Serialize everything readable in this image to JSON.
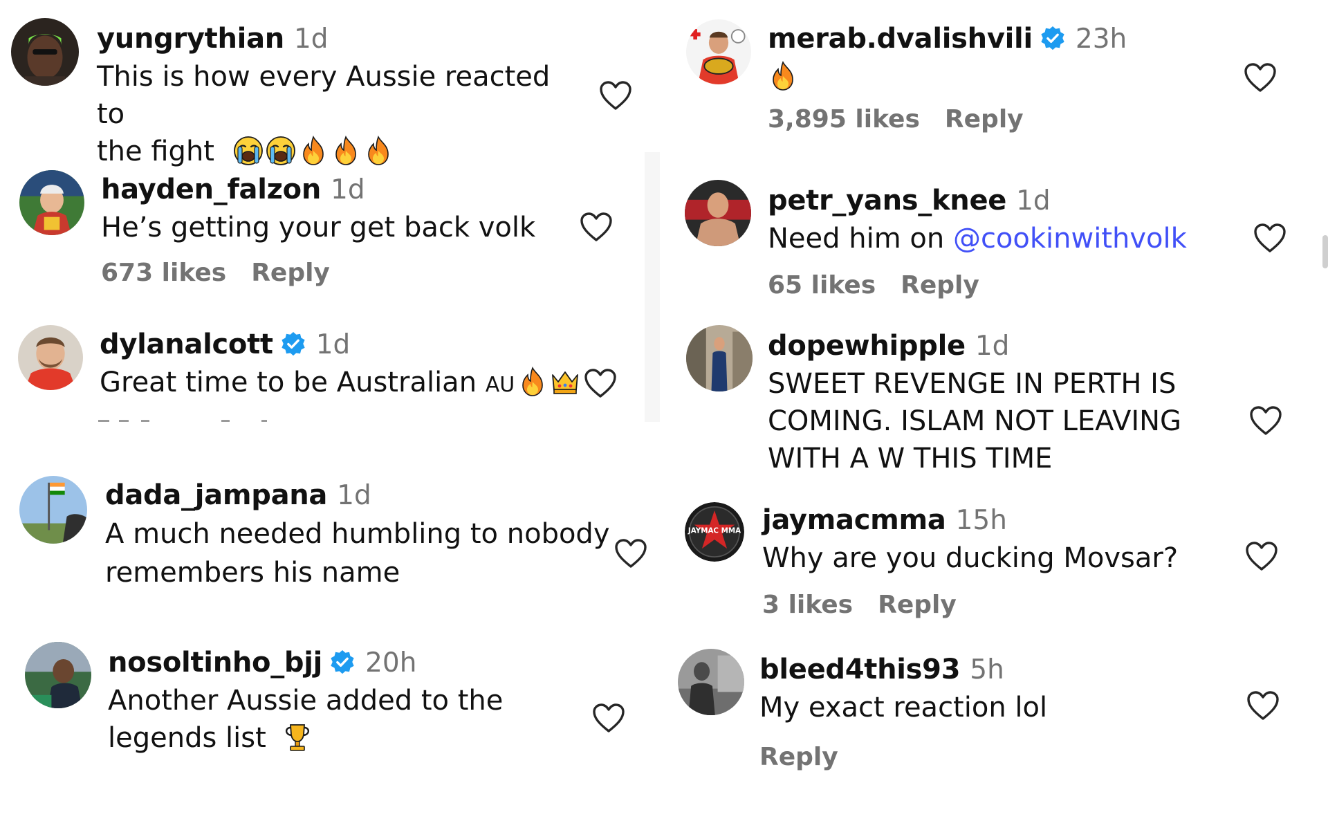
{
  "colors": {
    "text": "#111111",
    "muted": "#737373",
    "mention": "#4150f7",
    "verified": "#1d9bf0",
    "background": "#ffffff"
  },
  "comments": [
    {
      "username": "yungrythian",
      "verified": false,
      "time": "1d",
      "text_line1": "This is how every Aussie reacted to",
      "text_line2": "the fight",
      "emojis": [
        "crying-face",
        "crying-face",
        "fire",
        "fire",
        "fire"
      ],
      "likes": "",
      "reply": ""
    },
    {
      "username": "hayden_falzon",
      "verified": false,
      "time": "1d",
      "text": "He’s getting your get back volk",
      "likes": "673 likes",
      "reply": "Reply"
    },
    {
      "username": "dylanalcott",
      "verified": true,
      "time": "1d",
      "text": "Great time to be Australian",
      "flag_code": "AU",
      "emojis": [
        "fire",
        "crown"
      ],
      "likes": "",
      "reply": ""
    },
    {
      "username": "dada_jampana",
      "verified": false,
      "time": "1d",
      "text_line1": "A much needed humbling to nobody",
      "text_line2": "remembers his name",
      "likes": "",
      "reply": ""
    },
    {
      "username": "nosoltinho_bjj",
      "verified": true,
      "time": "20h",
      "text_line1": "Another Aussie added to the",
      "text_line2": "legends list",
      "emojis": [
        "trophy"
      ],
      "likes": "",
      "reply": ""
    },
    {
      "username": "merab.dvalishvili",
      "verified": true,
      "time": "23h",
      "emojis": [
        "fire"
      ],
      "likes": "3,895 likes",
      "reply": "Reply"
    },
    {
      "username": "petr_yans_knee",
      "verified": false,
      "time": "1d",
      "text": "Need him on ",
      "mention": "@cookinwithvolk",
      "likes": "65 likes",
      "reply": "Reply"
    },
    {
      "username": "dopewhipple",
      "verified": false,
      "time": "1d",
      "text_line1": "SWEET REVENGE IN PERTH IS",
      "text_line2": "COMING. ISLAM NOT LEAVING",
      "text_line3": "WITH A W THIS TIME",
      "likes": "",
      "reply": ""
    },
    {
      "username": "jaymacmma",
      "verified": false,
      "time": "15h",
      "text": "Why are you ducking Movsar?",
      "avatar_text": "JAYMAC MMA",
      "likes": "3 likes",
      "reply": "Reply"
    },
    {
      "username": "bleed4this93",
      "verified": false,
      "time": "5h",
      "text": "My exact reaction lol",
      "likes": "",
      "reply": "Reply"
    }
  ]
}
